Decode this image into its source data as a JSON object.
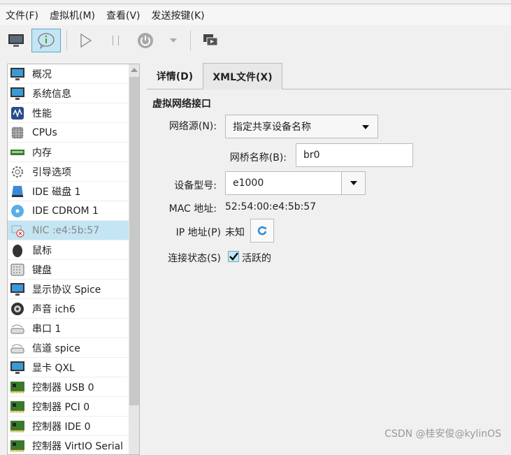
{
  "menu": [
    "文件(F)",
    "虚拟机(M)",
    "查看(V)",
    "发送按键(K)"
  ],
  "sidebar": {
    "items": [
      {
        "label": "概况",
        "icon": "monitor-icon"
      },
      {
        "label": "系统信息",
        "icon": "monitor-icon"
      },
      {
        "label": "性能",
        "icon": "performance-icon"
      },
      {
        "label": "CPUs",
        "icon": "cpu-icon"
      },
      {
        "label": "内存",
        "icon": "memory-icon"
      },
      {
        "label": "引导选项",
        "icon": "gear-icon"
      },
      {
        "label": "IDE 磁盘 1",
        "icon": "disk-icon"
      },
      {
        "label": "IDE CDROM 1",
        "icon": "cdrom-icon"
      },
      {
        "label": "NIC :e4:5b:57",
        "icon": "nic-icon"
      },
      {
        "label": "鼠标",
        "icon": "mouse-icon"
      },
      {
        "label": "键盘",
        "icon": "keyboard-icon"
      },
      {
        "label": "显示协议 Spice",
        "icon": "monitor-icon"
      },
      {
        "label": "声音 ich6",
        "icon": "speaker-icon"
      },
      {
        "label": "串口 1",
        "icon": "serial-icon"
      },
      {
        "label": "信道 spice",
        "icon": "serial-icon"
      },
      {
        "label": "显卡 QXL",
        "icon": "monitor-icon"
      },
      {
        "label": "控制器 USB 0",
        "icon": "controller-icon"
      },
      {
        "label": "控制器 PCI 0",
        "icon": "controller-icon"
      },
      {
        "label": "控制器 IDE 0",
        "icon": "controller-icon"
      },
      {
        "label": "控制器 VirtIO Serial",
        "icon": "controller-icon"
      }
    ]
  },
  "tabs": [
    "详情(D)",
    "XML文件(X)"
  ],
  "section": "虚拟网络接口",
  "form": {
    "source_label": "网络源(N):",
    "source_value": "指定共享设备名称",
    "bridge_label": "网桥名称(B):",
    "bridge_value": "br0",
    "model_label": "设备型号:",
    "model_value": "e1000",
    "mac_label": "MAC 地址:",
    "mac_value": "52:54:00:e4:5b:57",
    "ip_label": "IP 地址(P)",
    "ip_value": "未知",
    "link_label": "连接状态(S)",
    "link_value": "活跃的",
    "link_checked": true
  },
  "watermark": "CSDN @桂安俊@kylinOS"
}
